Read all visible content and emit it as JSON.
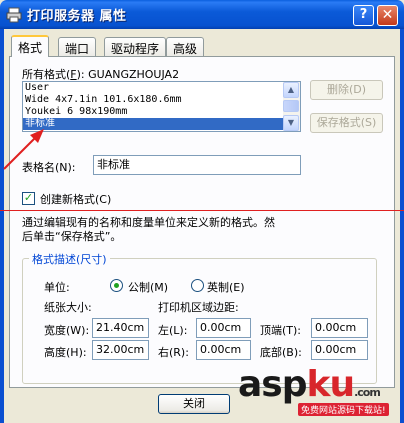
{
  "window": {
    "title": "打印服务器 属性",
    "help_label": "?",
    "close_label": "✕"
  },
  "tabs": [
    {
      "label": "格式"
    },
    {
      "label": "端口"
    },
    {
      "label": "驱动程序"
    },
    {
      "label": "高级"
    }
  ],
  "formats": {
    "header": "所有格式(F): GUANGZHOUJA2",
    "header_label": "所有格式(",
    "header_key": "F",
    "header_rest": "):  GUANGZHOUJA2",
    "items": [
      "User",
      "Wide 4x7.1in 101.6x180.6mm",
      "Youkei 6 98x190mm",
      "非标准"
    ],
    "selected_index": 3,
    "delete_button": "删除(D)",
    "save_button": "保存格式(S)"
  },
  "table_name": {
    "label": "表格名(N):",
    "value": "非标准"
  },
  "create_new": {
    "label": "创建新格式(C)",
    "checked": true
  },
  "description": "通过编辑现有的名称和度量单位来定义新的格式。然后单击“保存格式”。",
  "description_line1": "通过编辑现有的名称和度量单位来定义新的格式。然",
  "description_line2": "后单击“保存格式”。",
  "format_desc": {
    "title": "格式描述(尺寸)",
    "unit_label": "单位:",
    "metric_label": "公制(M)",
    "imperial_label": "英制(E)",
    "selected_unit": "metric",
    "paper_size_label": "纸张大小:",
    "printer_margin_label": "打印机区域边距:",
    "width_label": "宽度(W):",
    "width_value": "21.40cm",
    "height_label": "高度(H):",
    "height_value": "32.00cm",
    "left_label": "左(L):",
    "left_value": "0.00cm",
    "right_label": "右(R):",
    "right_value": "0.00cm",
    "top_label": "顶端(T):",
    "top_value": "0.00cm",
    "bottom_label": "底部(B):",
    "bottom_value": "0.00cm"
  },
  "buttons": {
    "close": "关闭"
  },
  "watermark": {
    "main_asp": "asp",
    "main_ku": "ku",
    "suffix": ".com",
    "small": "免费网站源码下载站!"
  },
  "colors": {
    "titlebar": "#0a5fde",
    "selection": "#316ac5",
    "group_title": "#0046d5",
    "annotation_red": "#e02020"
  }
}
